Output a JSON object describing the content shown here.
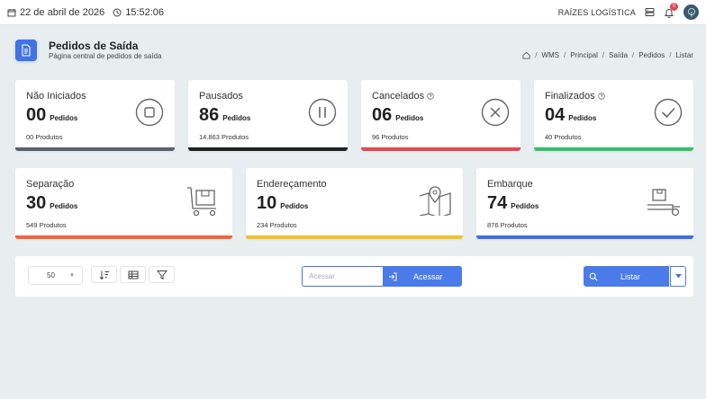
{
  "topbar": {
    "date": "22 de abril de 2026",
    "time": "15:52:06",
    "company": "RAÍZES LOGÍSTICA",
    "notifications": "0"
  },
  "header": {
    "title": "Pedidos de Saída",
    "subtitle": "Página central de pedidos de saída",
    "breadcrumb": [
      "WMS",
      "Principal",
      "Saída",
      "Pedidos",
      "Listar"
    ],
    "breadcrumb_sep": "/"
  },
  "cards_top": [
    {
      "label": "Não Iniciados",
      "count": "00",
      "unit": "Pedidos",
      "products": "00 Produtos",
      "color": "#5a6268",
      "icon": "stop-icon",
      "help": false
    },
    {
      "label": "Pausados",
      "count": "86",
      "unit": "Pedidos",
      "products": "14.863 Produtos",
      "color": "#1f2227",
      "icon": "pause-icon",
      "help": false
    },
    {
      "label": "Cancelados",
      "count": "06",
      "unit": "Pedidos",
      "products": "96 Produtos",
      "color": "#e64553",
      "icon": "close-circle-icon",
      "help": true
    },
    {
      "label": "Finalizados",
      "count": "04",
      "unit": "Pedidos",
      "products": "40 Produtos",
      "color": "#2fc36b",
      "icon": "check-circle-icon",
      "help": true
    }
  ],
  "cards_bottom": [
    {
      "label": "Separação",
      "count": "30",
      "unit": "Pedidos",
      "products": "549 Produtos",
      "color": "#f2643a",
      "icon": "cart-box-icon"
    },
    {
      "label": "Endereçamento",
      "count": "10",
      "unit": "Pedidos",
      "products": "234 Produtos",
      "color": "#f3c22b",
      "icon": "map-pin-icon"
    },
    {
      "label": "Embarque",
      "count": "74",
      "unit": "Pedidos",
      "products": "876 Produtos",
      "color": "#3f6fe0",
      "icon": "hand-truck-icon"
    }
  ],
  "toolbar": {
    "page_size": "50",
    "search_placeholder": "Acessar",
    "search_button": "Acessar",
    "list_button": "Listar"
  }
}
